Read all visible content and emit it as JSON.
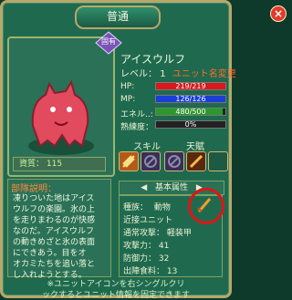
{
  "window": {
    "title": "普通",
    "close_label": "×"
  },
  "unit": {
    "name": "アイスウルフ",
    "level_label": "レベル：",
    "level": "1",
    "unit_fixed": "ユニット名変更",
    "rank_badge": "固有"
  },
  "stats": {
    "hp_label": "HP:",
    "hp_value": "219/219",
    "hp_ratio": 1,
    "mp_label": "MP:",
    "mp_value": "126/126",
    "mp_ratio": 1,
    "energy_label": "エネル..:",
    "energy_value": "480/500",
    "energy_ratio": 0.96,
    "prof_label": "熟練度：",
    "prof_value": "0%",
    "prof_ratio": 0
  },
  "quality": {
    "label": "資質：",
    "value": "115"
  },
  "sections": {
    "skill": "スキル",
    "talent": "天賦"
  },
  "description": {
    "title": "部隊説明：",
    "text": "凍りついた地はアイス\nウルフの楽園。氷の上\nを走りまわるのが快感\nなのだ。アイスウルフ\nの動きめざと氷の表面\nにできあう。目をオ\nオカミたちを追い落と\nし入れようとする。"
  },
  "attributes": {
    "tab_label": "基本属性",
    "rows": [
      {
        "label": "種族：",
        "value": "動物"
      },
      {
        "label": "近接ユニット",
        "value": ""
      },
      {
        "label": "通常攻撃：",
        "value": "軽装甲"
      },
      {
        "label": "攻撃力：",
        "value": "41"
      },
      {
        "label": "防御力：",
        "value": "32"
      },
      {
        "label": "出陣食料：",
        "value": "13"
      }
    ]
  },
  "footer": {
    "line1": "※ユニットアイコンを右シングルクリ",
    "line2": "ックするとユニット情報を固定できます"
  },
  "colors": {
    "hp": "#d61a1a",
    "mp": "#1a3ed6",
    "energy": "#2a9a2a",
    "prof": "#333333"
  }
}
